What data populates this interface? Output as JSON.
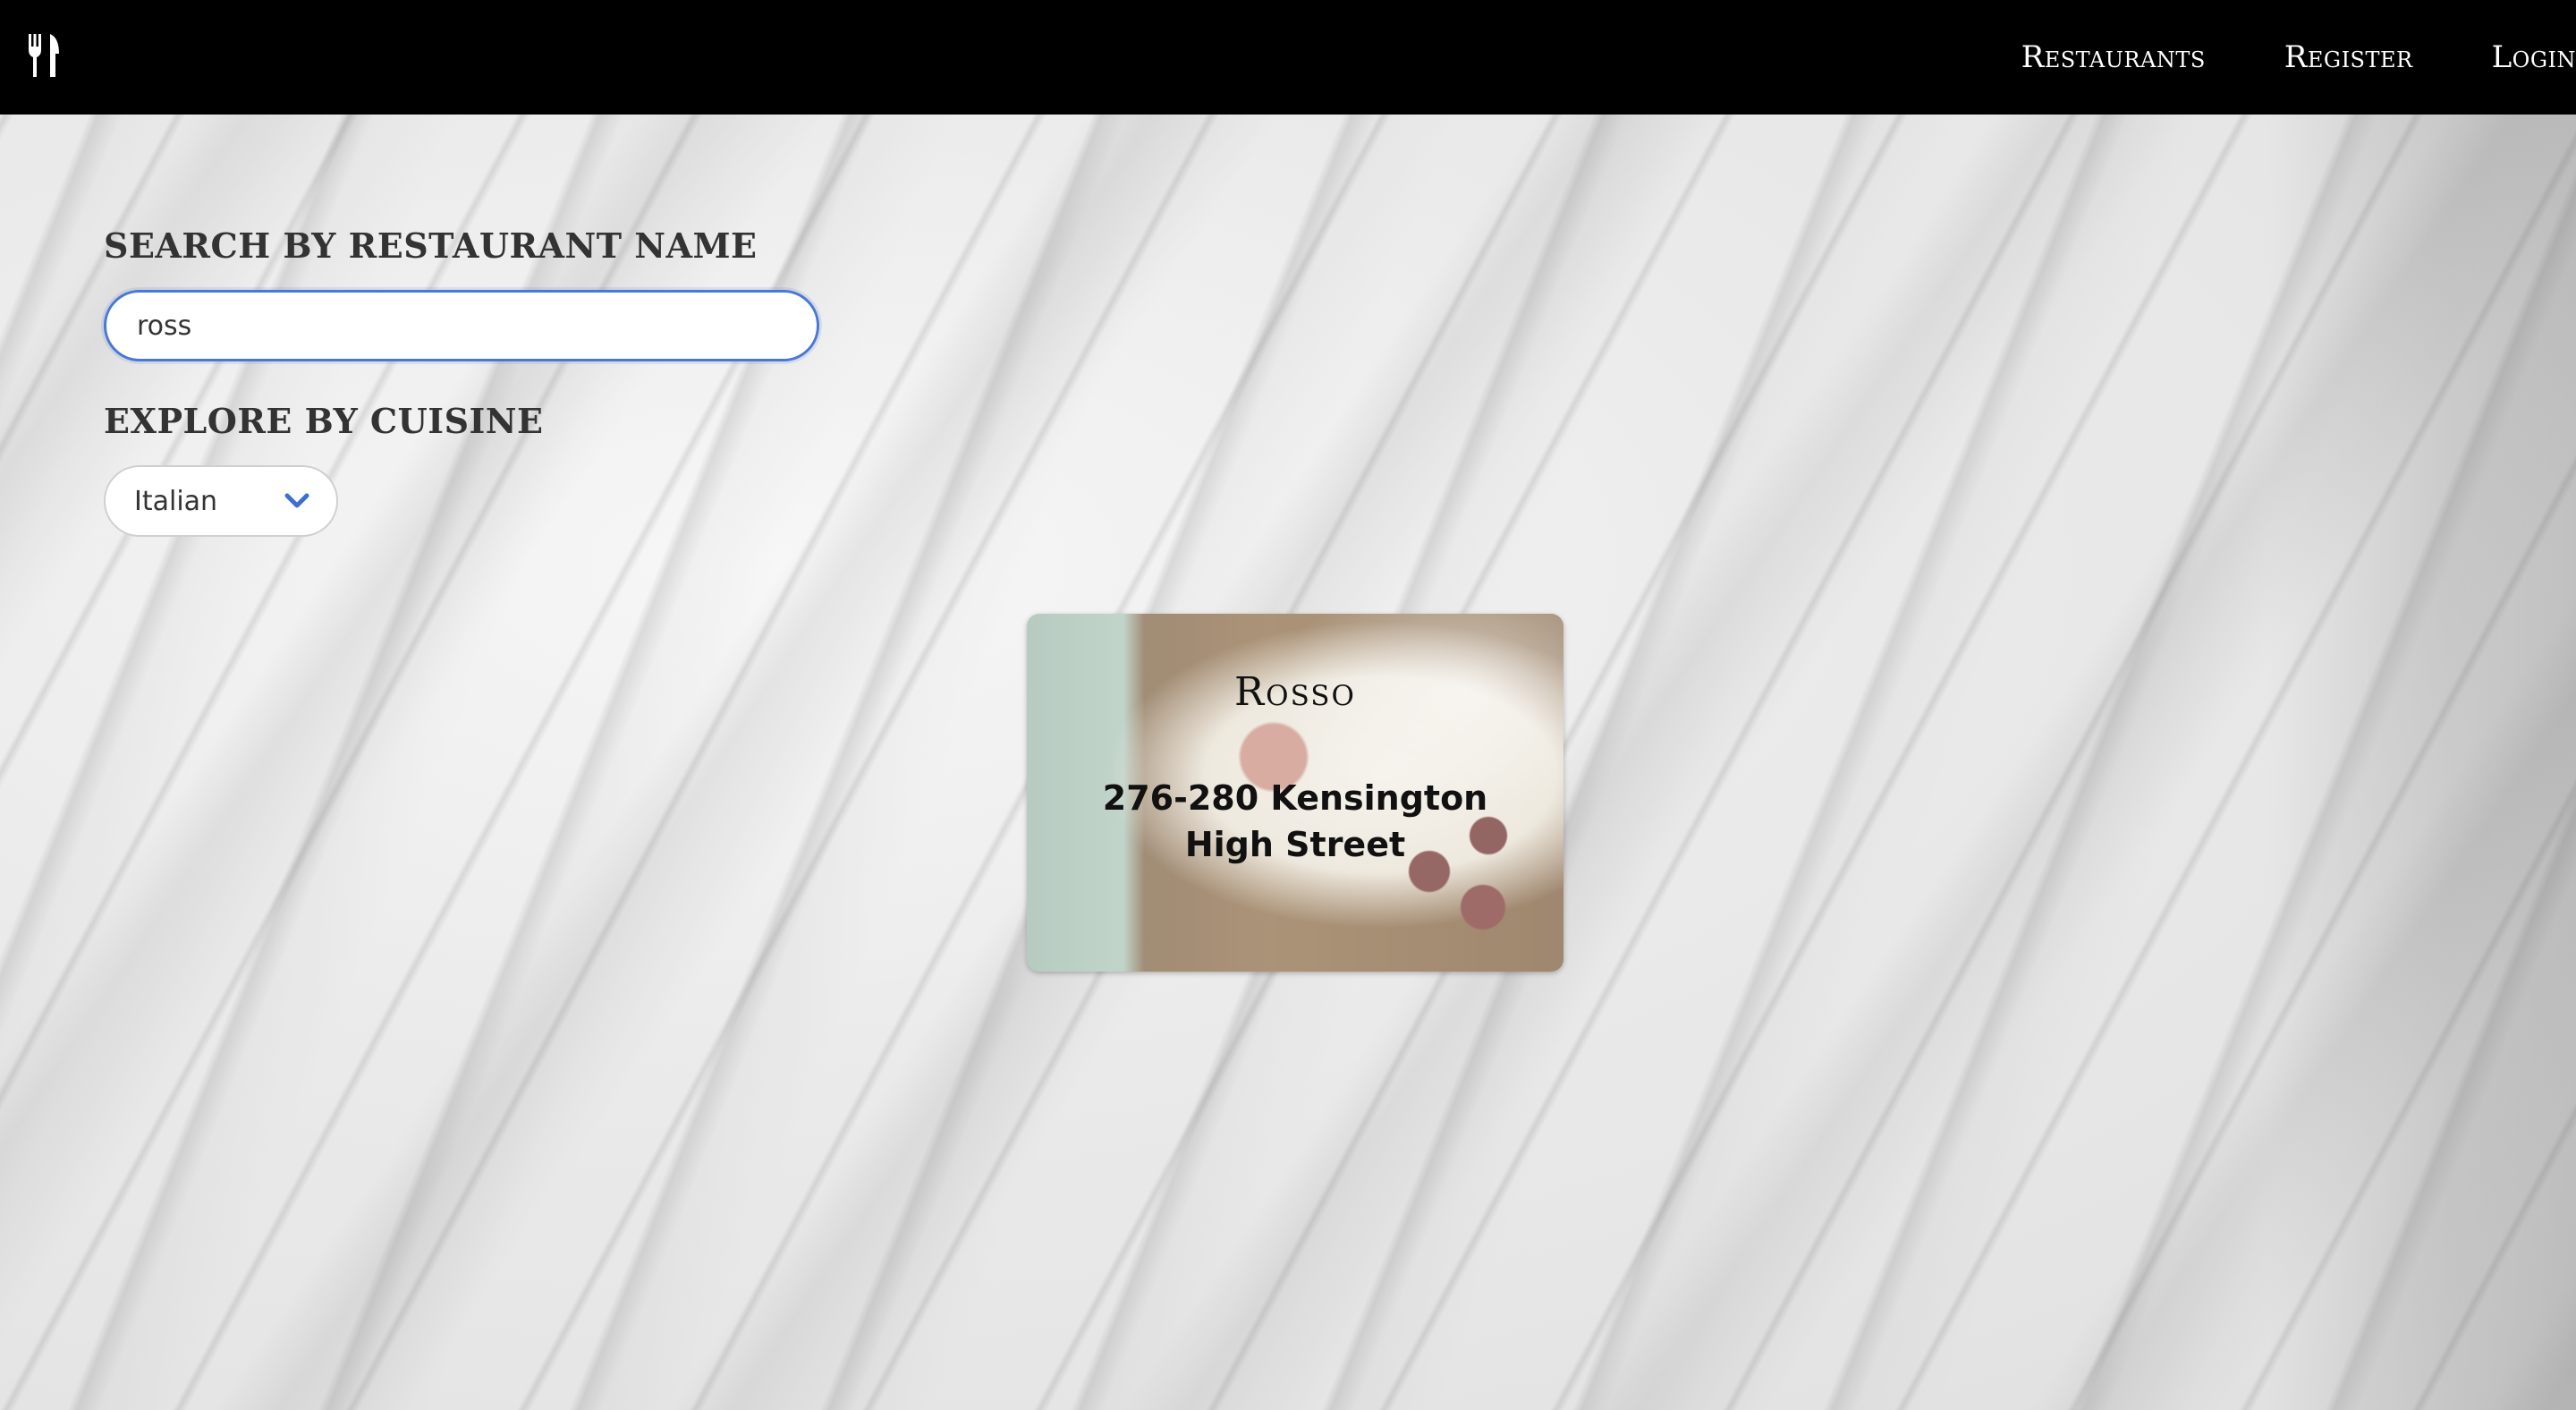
{
  "nav": {
    "logo_icon": "fork-knife-icon",
    "links": [
      "Restaurants",
      "Register",
      "Login"
    ]
  },
  "search": {
    "label": "SEARCH BY RESTAURANT NAME",
    "value": "ross",
    "placeholder": ""
  },
  "cuisine": {
    "label": "EXPLORE BY CUISINE",
    "selected": "Italian",
    "icon": "chevron-down-icon",
    "accent_color": "#3e6fd0"
  },
  "results": [
    {
      "name": "Rosso",
      "address": "276-280 Kensington High Street"
    }
  ],
  "colors": {
    "navbar": "#000000",
    "focus_ring": "#4a78d6"
  }
}
